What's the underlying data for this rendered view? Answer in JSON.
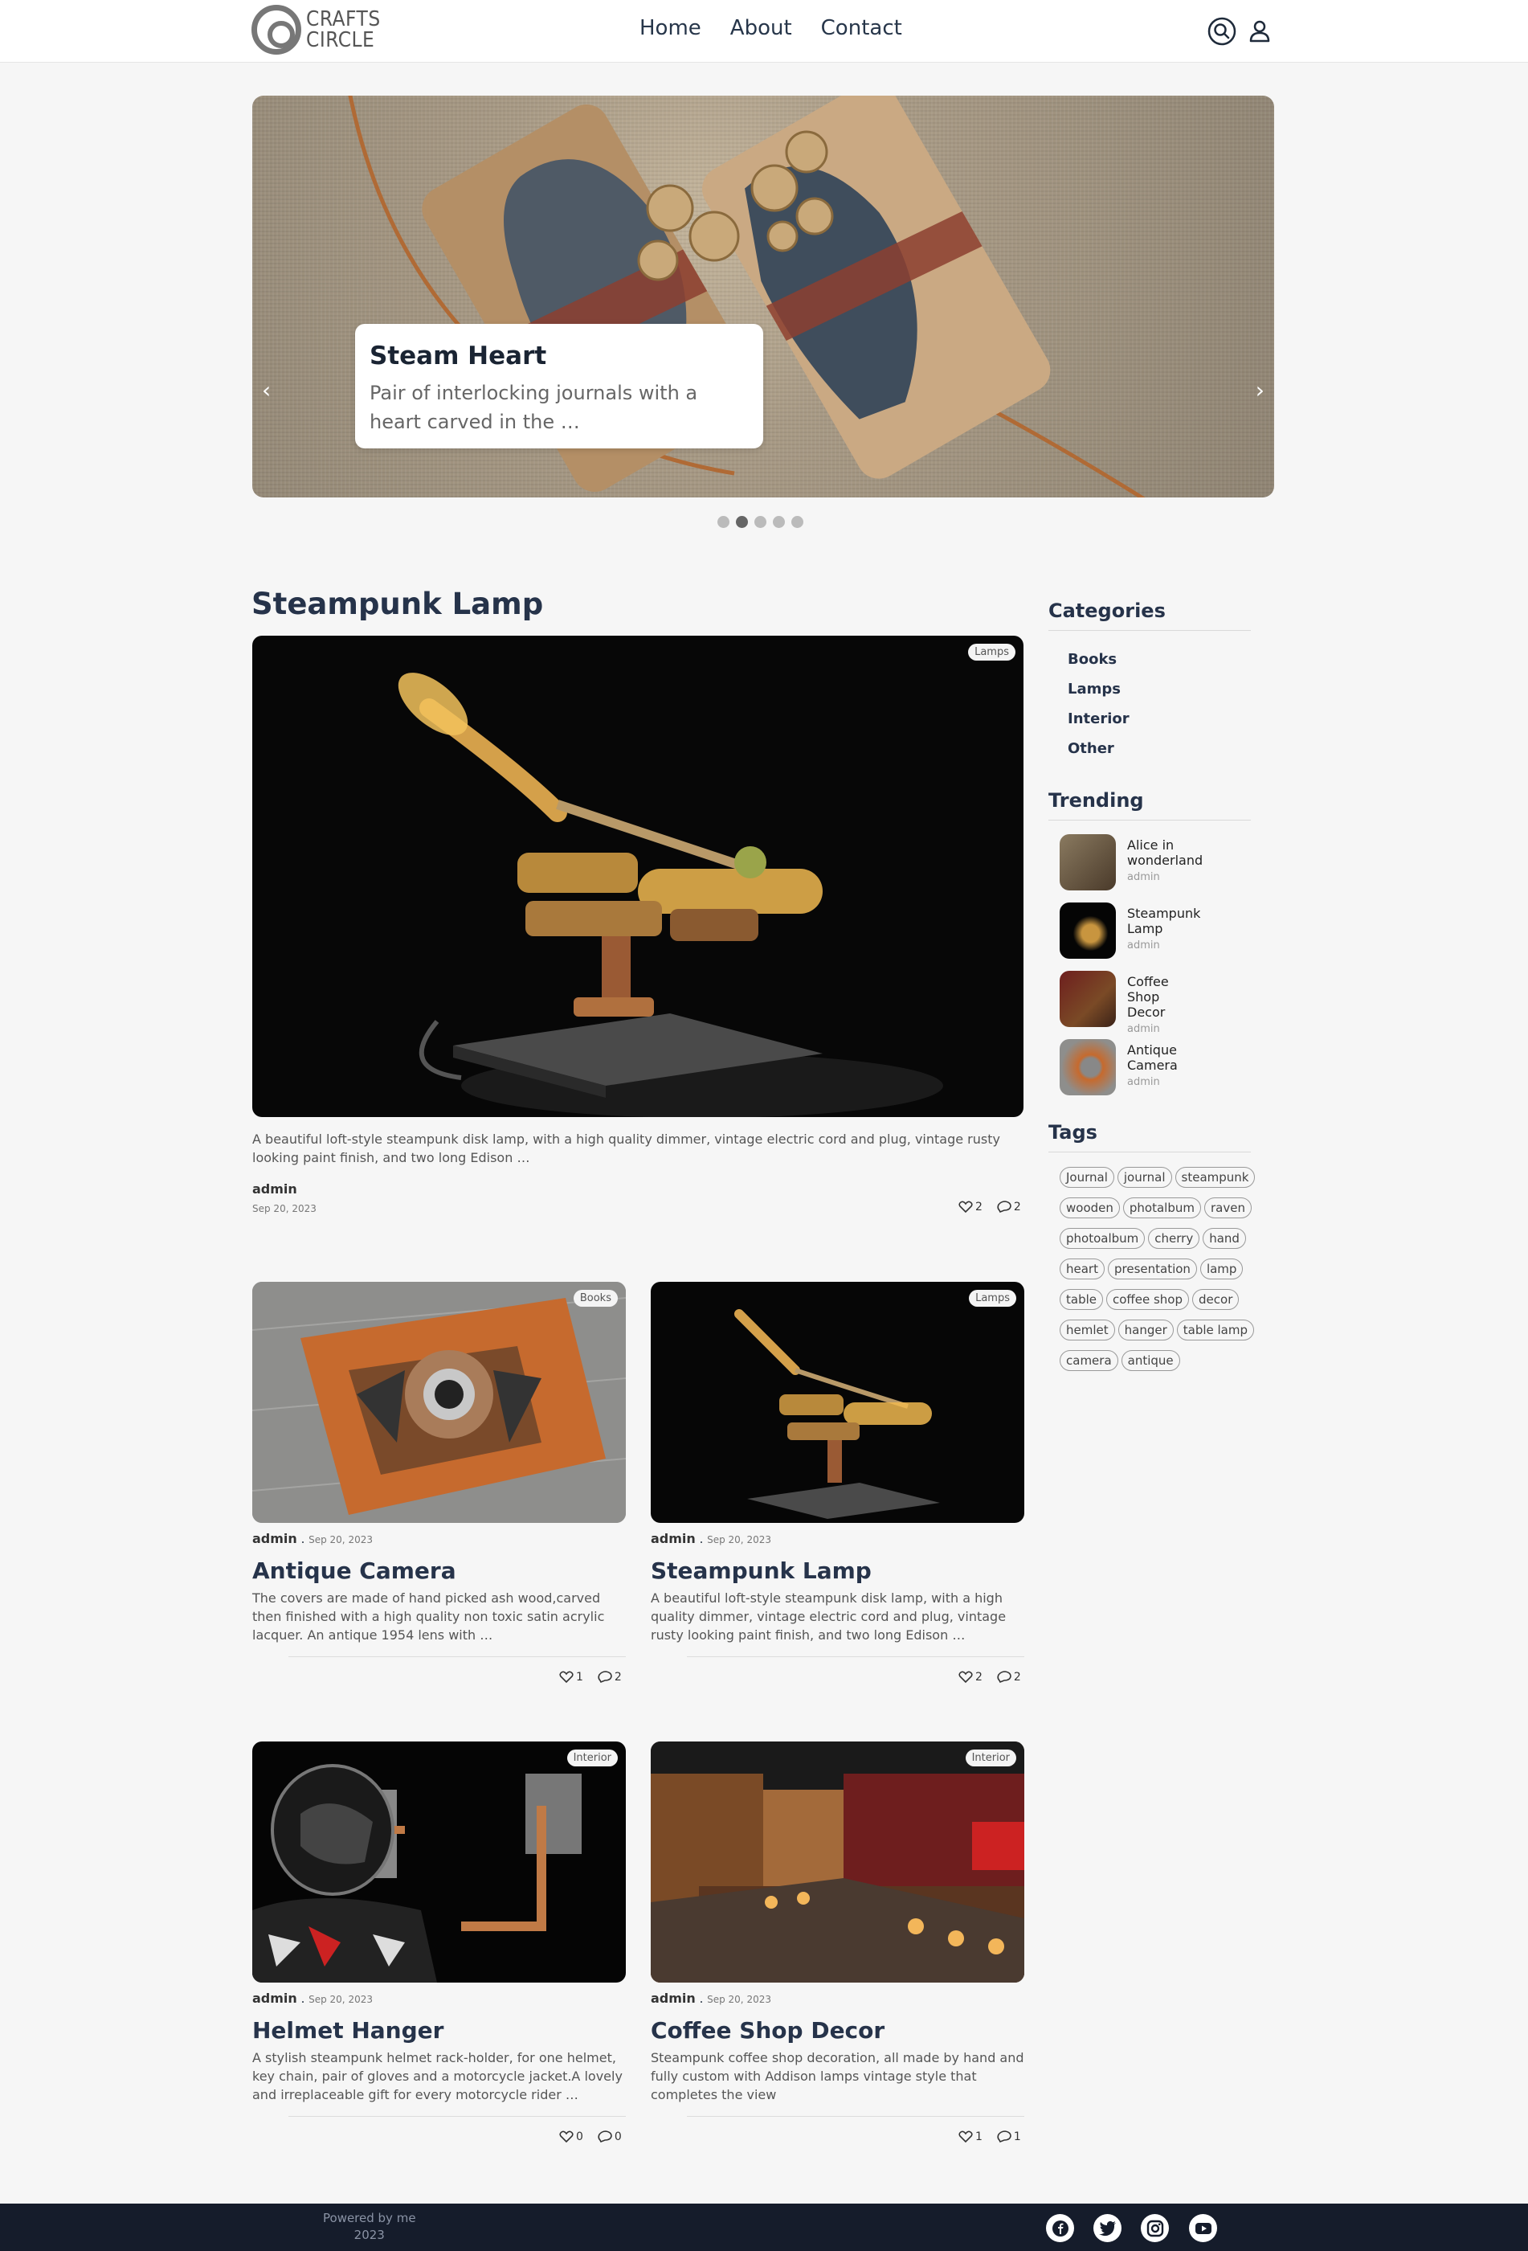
{
  "header": {
    "logo": {
      "line1": "CRAFTS",
      "line2": "CIRCLE"
    },
    "nav": [
      {
        "label": "Home"
      },
      {
        "label": "About"
      },
      {
        "label": "Contact"
      }
    ],
    "icons": [
      "search-icon",
      "user-icon"
    ]
  },
  "carousel": {
    "slide_title": "Steam Heart",
    "slide_text": "Pair of interlocking journals with a heart carved in the …",
    "prev": "‹",
    "next": "›",
    "dot_count": 5,
    "active_dot": 1
  },
  "featured": {
    "title": "Steampunk Lamp",
    "badge": "Lamps",
    "excerpt": "A beautiful loft-style steampunk disk lamp, with a high quality dimmer, vintage electric cord and plug, vintage rusty looking paint finish, and two long Edison …",
    "author": "admin",
    "date": "Sep 20, 2023",
    "likes": "2",
    "comments": "2"
  },
  "posts": [
    {
      "badge": "Books",
      "author": "admin",
      "date": "Sep 20, 2023",
      "title": "Antique Camera",
      "excerpt": "The covers are made of hand picked ash wood,carved then finished with a high quality non toxic  satin acrylic lacquer. An antique 1954 lens with …",
      "likes": "1",
      "comments": "2"
    },
    {
      "badge": "Lamps",
      "author": "admin",
      "date": "Sep 20, 2023",
      "title": "Steampunk Lamp",
      "excerpt": "A beautiful loft-style steampunk disk lamp, with a high quality dimmer, vintage electric cord and plug, vintage rusty looking paint finish, and two long Edison …",
      "likes": "2",
      "comments": "2"
    },
    {
      "badge": "Interior",
      "author": "admin",
      "date": "Sep 20, 2023",
      "title": "Helmet Hanger",
      "excerpt": "A stylish steampunk helmet rack-holder, for one helmet, key chain, pair of gloves and a motorcycle jacket.A lovely and irreplaceable gift for every motorcycle rider …",
      "likes": "0",
      "comments": "0"
    },
    {
      "badge": "Interior",
      "author": "admin",
      "date": "Sep 20, 2023",
      "title": "Coffee Shop Decor",
      "excerpt": "Steampunk coffee shop decoration, all made by hand and fully custom with Addison lamps vintage style that completes the view",
      "likes": "1",
      "comments": "1"
    }
  ],
  "sidebar": {
    "categories_title": "Categories",
    "categories": [
      "Books",
      "Lamps",
      "Interior",
      "Other"
    ],
    "trending_title": "Trending",
    "trending": [
      {
        "name": "Alice in wonderland",
        "author": "admin"
      },
      {
        "name": "Steampunk Lamp",
        "author": "admin"
      },
      {
        "name": "Coffee Shop Decor",
        "author": "admin"
      },
      {
        "name": "Antique Camera",
        "author": "admin"
      }
    ],
    "tags_title": "Tags",
    "tags": [
      "Journal",
      "journal",
      "steampunk",
      "wooden",
      "photalbum",
      "raven",
      "photoalbum",
      "cherry",
      "hand",
      "heart",
      "presentation",
      "lamp",
      "table",
      "coffee shop",
      "decor",
      "hemlet",
      "hanger",
      "table lamp",
      "camera",
      "antique"
    ]
  },
  "footer": {
    "powered": "Powered by me",
    "year": "2023",
    "social": [
      "facebook-icon",
      "twitter-icon",
      "instagram-icon",
      "youtube-icon"
    ]
  }
}
